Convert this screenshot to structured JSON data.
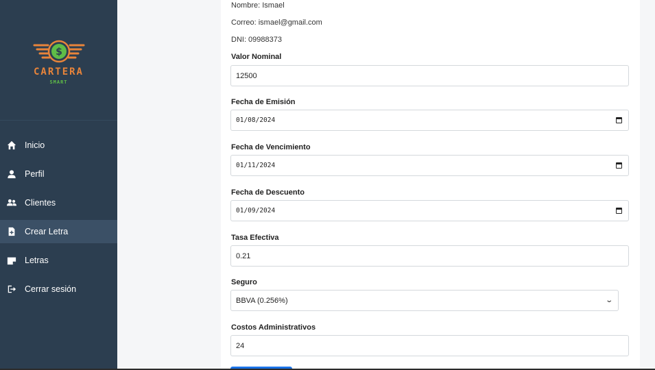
{
  "brand": {
    "title": "CARTERA",
    "subtitle": "SMART",
    "colors": {
      "orange": "#e8843a",
      "green": "#5fbd47",
      "sidebar": "#2c3e50"
    }
  },
  "nav": {
    "items": [
      {
        "label": "Inicio",
        "icon": "home-icon"
      },
      {
        "label": "Perfil",
        "icon": "user-icon"
      },
      {
        "label": "Clientes",
        "icon": "users-icon"
      },
      {
        "label": "Crear Letra",
        "icon": "file-plus-icon",
        "active": true
      },
      {
        "label": "Letras",
        "icon": "file-icon"
      },
      {
        "label": "Cerrar sesión",
        "icon": "logout-icon"
      }
    ]
  },
  "client": {
    "name": "Nombre: Ismael",
    "email": "Correo: ismael@gmail.com",
    "dni": "DNI: 09988373"
  },
  "form": {
    "valor_nominal": {
      "label": "Valor Nominal",
      "value": "12500"
    },
    "fecha_emision": {
      "label": "Fecha de Emisión",
      "value": "01/08/2024"
    },
    "fecha_vencimiento": {
      "label": "Fecha de Vencimiento",
      "value": "01/11/2024"
    },
    "fecha_descuento": {
      "label": "Fecha de Descuento",
      "value": "01/09/2024"
    },
    "tasa_efectiva": {
      "label": "Tasa Efectiva",
      "value": "0.21"
    },
    "seguro": {
      "label": "Seguro",
      "value": "BBVA (0.256%)"
    },
    "costos_administrativos": {
      "label": "Costos Administrativos",
      "value": "24"
    }
  }
}
